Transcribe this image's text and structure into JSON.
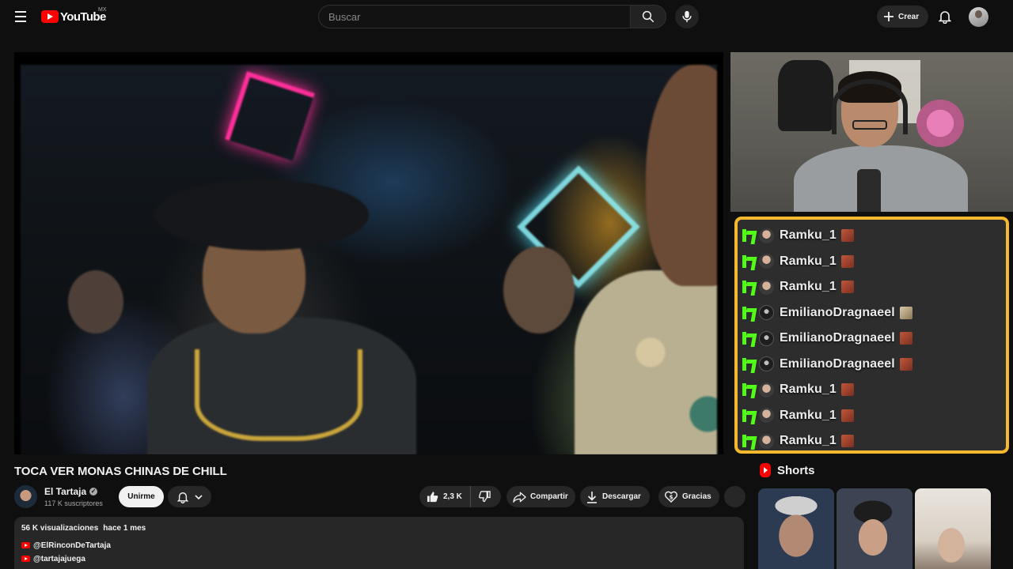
{
  "header": {
    "logo_text": "YouTube",
    "country_code": "MX",
    "search_placeholder": "Buscar",
    "create_label": "Crear"
  },
  "video": {
    "title": "TOCA VER MONAS CHINAS DE CHILL",
    "channel_name": "El Tartaja",
    "subscribers": "117 K suscriptores",
    "join_label": "Unirme",
    "likes": "2,3 K",
    "share_label": "Compartir",
    "download_label": "Descargar",
    "thanks_label": "Gracias"
  },
  "description": {
    "views": "56 K visualizaciones",
    "date": "hace 1 mes",
    "links": [
      "@ElRinconDeTartaja",
      "@tartajajuega"
    ]
  },
  "chat": {
    "messages": [
      {
        "user": "Ramku_1",
        "avatar": "photo",
        "emote": "red-emote"
      },
      {
        "user": "Ramku_1",
        "avatar": "photo",
        "emote": "red-emote"
      },
      {
        "user": "Ramku_1",
        "avatar": "photo",
        "emote": "red-emote"
      },
      {
        "user": "EmilianoDragnaeel",
        "avatar": "default",
        "emote": "pug-emote"
      },
      {
        "user": "EmilianoDragnaeel",
        "avatar": "default",
        "emote": "red-emote"
      },
      {
        "user": "EmilianoDragnaeel",
        "avatar": "default",
        "emote": "red-emote"
      },
      {
        "user": "Ramku_1",
        "avatar": "photo",
        "emote": "red-emote"
      },
      {
        "user": "Ramku_1",
        "avatar": "photo",
        "emote": "red-emote"
      },
      {
        "user": "Ramku_1",
        "avatar": "photo",
        "emote": "red-emote"
      }
    ],
    "border_color": "#f5b82e",
    "platform_icon": "kick-icon",
    "platform_color": "#53fc18"
  },
  "shorts": {
    "title": "Shorts"
  },
  "colors": {
    "background": "#0f0f0f",
    "brand": "#ff0000",
    "pill": "#272727"
  }
}
